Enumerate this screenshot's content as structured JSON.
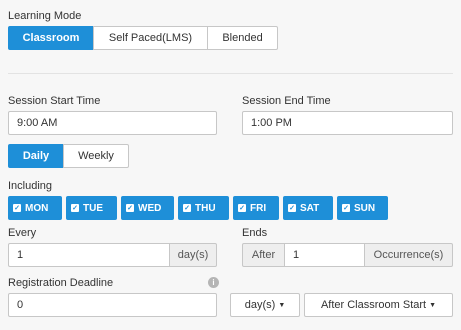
{
  "learning_mode": {
    "label": "Learning Mode",
    "options": [
      "Classroom",
      "Self Paced(LMS)",
      "Blended"
    ],
    "selected": "Classroom"
  },
  "session": {
    "start_label": "Session Start Time",
    "start_value": "9:00 AM",
    "end_label": "Session End Time",
    "end_value": "1:00 PM"
  },
  "frequency": {
    "options": [
      "Daily",
      "Weekly"
    ],
    "selected": "Daily"
  },
  "including": {
    "label": "Including",
    "days": [
      "MON",
      "TUE",
      "WED",
      "THU",
      "FRI",
      "SAT",
      "SUN"
    ],
    "check_glyph": "✓"
  },
  "every": {
    "label": "Every",
    "value": "1",
    "unit": "day(s)"
  },
  "ends": {
    "label": "Ends",
    "prefix": "After",
    "value": "1",
    "unit": "Occurrence(s)"
  },
  "registration": {
    "label": "Registration Deadline",
    "value": "0",
    "unit_dropdown": "day(s)",
    "relative_dropdown": "After Classroom Start",
    "info_glyph": "i",
    "caret_glyph": "▼"
  },
  "colors": {
    "accent": "#1e8fd8",
    "background": "#f7f7f7",
    "border": "#c7c7c7"
  }
}
